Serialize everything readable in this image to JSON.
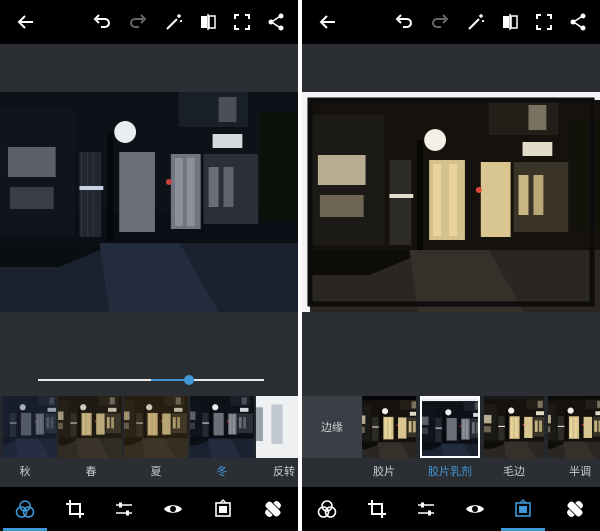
{
  "left": {
    "slider": {
      "value": 0.67
    },
    "filters": [
      {
        "label": "秋",
        "tint": "#2b3550"
      },
      {
        "label": "春",
        "tint": "#4a3a2a"
      },
      {
        "label": "夏",
        "tint": "#5a4220"
      },
      {
        "label": "冬",
        "tint": "#22344f",
        "selected": true
      },
      {
        "label": "反转",
        "tint": "#d8d8d8"
      }
    ]
  },
  "right": {
    "category_label": "边缘",
    "borders": [
      {
        "label": "胶片"
      },
      {
        "label": "胶片乳剂",
        "selected": true
      },
      {
        "label": "毛边"
      },
      {
        "label": "半调"
      }
    ]
  },
  "colors": {
    "accent": "#3f97d6",
    "panel_bg": "#2b2e33",
    "bar_bg": "#000000"
  },
  "icons": {
    "top": [
      "back-arrow-icon",
      "undo-icon",
      "redo-icon",
      "magic-wand-icon",
      "compare-icon",
      "fullscreen-icon",
      "share-icon"
    ],
    "bottom": [
      "filters-icon",
      "crop-icon",
      "adjust-icon",
      "eye-icon",
      "border-frame-icon",
      "healing-icon"
    ]
  },
  "bottom_active": {
    "left": "filters",
    "right": "borders"
  }
}
